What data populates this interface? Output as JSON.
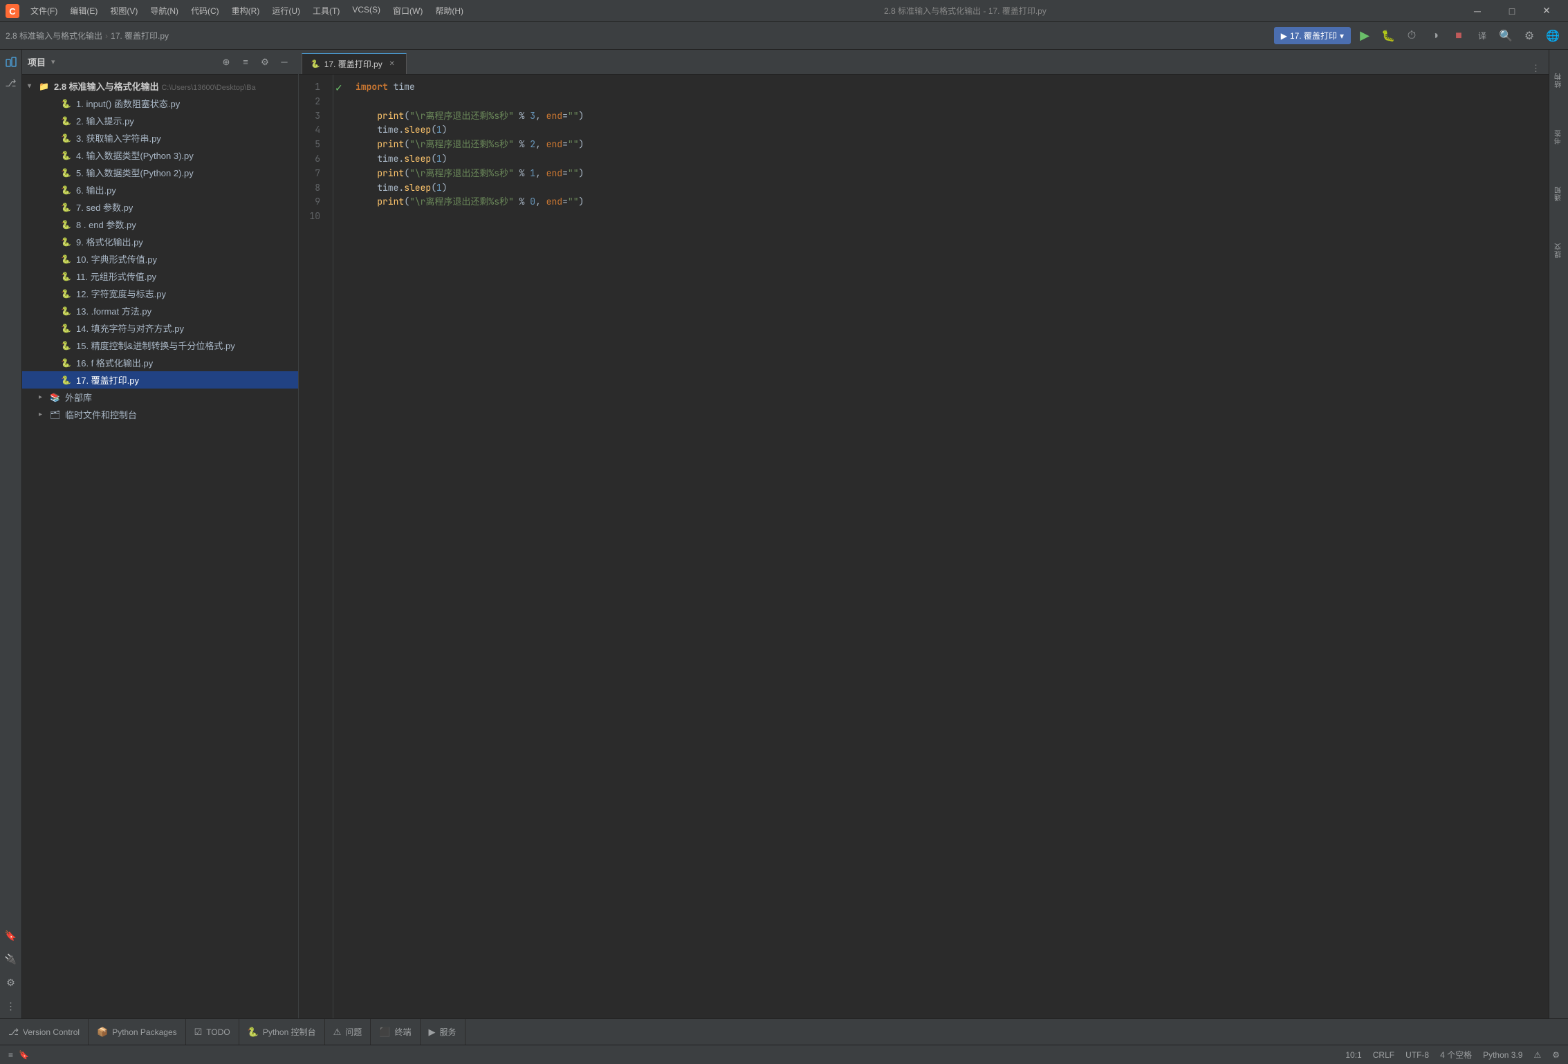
{
  "window": {
    "title": "2.8 标准输入与格式化输出 - 17. 覆盖打印.py",
    "logo": "🐉"
  },
  "titlebar": {
    "menus": [
      "文件(F)",
      "编辑(E)",
      "视图(V)",
      "导航(N)",
      "代码(C)",
      "重构(R)",
      "运行(U)",
      "工具(T)",
      "VCS(S)",
      "窗口(W)",
      "帮助(H)"
    ],
    "center_text": "2.8 标准输入与格式化输出 - 17. 覆盖打印.py",
    "minimize": "─",
    "maximize": "□",
    "close": "✕"
  },
  "toolbar": {
    "breadcrumb_root": "2.8 标准输入与格式化输出",
    "breadcrumb_sep": "›",
    "breadcrumb_file": "17. 覆盖打印.py",
    "run_config": "17. 覆盖打印",
    "run_icon": "▶",
    "debug_icon": "🐛",
    "profile_icon": "⏱",
    "coverage_icon": "◑",
    "stop_icon": "■",
    "translate_icon": "译",
    "search_icon": "🔍",
    "settings_icon": "⚙",
    "theme_icon": "🌐"
  },
  "sidebar": {
    "panel_title": "项目",
    "dropdown_icon": "▾"
  },
  "file_tree": {
    "root_label": "2.8 标准输入与格式化输出",
    "root_path": "C:\\Users\\13600\\Desktop\\Ba",
    "items": [
      {
        "id": 1,
        "label": "1. input() 函数阻塞状态.py",
        "indent": 2,
        "type": "py"
      },
      {
        "id": 2,
        "label": "2. 输入提示.py",
        "indent": 2,
        "type": "py"
      },
      {
        "id": 3,
        "label": "3. 获取输入字符串.py",
        "indent": 2,
        "type": "py"
      },
      {
        "id": 4,
        "label": "4. 输入数据类型(Python 3).py",
        "indent": 2,
        "type": "py"
      },
      {
        "id": 5,
        "label": "5. 输入数据类型(Python 2).py",
        "indent": 2,
        "type": "py"
      },
      {
        "id": 6,
        "label": "6. 输出.py",
        "indent": 2,
        "type": "py"
      },
      {
        "id": 7,
        "label": "7. sed 参数.py",
        "indent": 2,
        "type": "py"
      },
      {
        "id": 8,
        "label": "8 . end 参数.py",
        "indent": 2,
        "type": "py"
      },
      {
        "id": 9,
        "label": "9. 格式化输出.py",
        "indent": 2,
        "type": "py"
      },
      {
        "id": 10,
        "label": "10. 字典形式传值.py",
        "indent": 2,
        "type": "py"
      },
      {
        "id": 11,
        "label": "11. 元组形式传值.py",
        "indent": 2,
        "type": "py"
      },
      {
        "id": 12,
        "label": "12. 字符宽度与标志.py",
        "indent": 2,
        "type": "py"
      },
      {
        "id": 13,
        "label": "13. .format 方法.py",
        "indent": 2,
        "type": "py"
      },
      {
        "id": 14,
        "label": "14. 填充字符与对齐方式.py",
        "indent": 2,
        "type": "py"
      },
      {
        "id": 15,
        "label": "15. 精度控制&进制转换与千分位格式.py",
        "indent": 2,
        "type": "py"
      },
      {
        "id": 16,
        "label": "16. f 格式化输出.py",
        "indent": 2,
        "type": "py"
      },
      {
        "id": 17,
        "label": "17. 覆盖打印.py",
        "indent": 2,
        "type": "py",
        "selected": true
      }
    ],
    "group_items": [
      {
        "label": "外部库",
        "collapsed": true,
        "indent": 1
      },
      {
        "label": "临时文件和控制台",
        "collapsed": true,
        "indent": 1
      }
    ]
  },
  "editor": {
    "tab_label": "17. 覆盖打印.py",
    "tab_modified": false,
    "code_lines": [
      {
        "num": 1,
        "content": "import time",
        "tokens": [
          {
            "text": "import",
            "cls": "kw"
          },
          {
            "text": " time",
            "cls": "plain"
          }
        ]
      },
      {
        "num": 2,
        "content": "",
        "tokens": []
      },
      {
        "num": 3,
        "content": "    print(\"\\r离程序退出还剩%s秒\" % 3, end=\"\")",
        "tokens": [
          {
            "text": "    ",
            "cls": "plain"
          },
          {
            "text": "print",
            "cls": "fn"
          },
          {
            "text": "(",
            "cls": "plain"
          },
          {
            "text": "\"\\r离程序退出还剩%s秒\"",
            "cls": "str"
          },
          {
            "text": " % ",
            "cls": "plain"
          },
          {
            "text": "3",
            "cls": "num"
          },
          {
            "text": ", ",
            "cls": "plain"
          },
          {
            "text": "end",
            "cls": "param-kw"
          },
          {
            "text": "=",
            "cls": "plain"
          },
          {
            "text": "\"\"",
            "cls": "str"
          },
          {
            "text": ")",
            "cls": "plain"
          }
        ]
      },
      {
        "num": 4,
        "content": "    time.sleep(1)",
        "tokens": [
          {
            "text": "    time.",
            "cls": "plain"
          },
          {
            "text": "sleep",
            "cls": "fn"
          },
          {
            "text": "(",
            "cls": "plain"
          },
          {
            "text": "1",
            "cls": "num"
          },
          {
            "text": ")",
            "cls": "plain"
          }
        ]
      },
      {
        "num": 5,
        "content": "    print(\"\\r离程序退出还剩%s秒\" % 2, end=\"\")",
        "tokens": [
          {
            "text": "    ",
            "cls": "plain"
          },
          {
            "text": "print",
            "cls": "fn"
          },
          {
            "text": "(",
            "cls": "plain"
          },
          {
            "text": "\"\\r离程序退出还剩%s秒\"",
            "cls": "str"
          },
          {
            "text": " % ",
            "cls": "plain"
          },
          {
            "text": "2",
            "cls": "num"
          },
          {
            "text": ", ",
            "cls": "plain"
          },
          {
            "text": "end",
            "cls": "param-kw"
          },
          {
            "text": "=",
            "cls": "plain"
          },
          {
            "text": "\"\"",
            "cls": "str"
          },
          {
            "text": ")",
            "cls": "plain"
          }
        ]
      },
      {
        "num": 6,
        "content": "    time.sleep(1)",
        "tokens": [
          {
            "text": "    time.",
            "cls": "plain"
          },
          {
            "text": "sleep",
            "cls": "fn"
          },
          {
            "text": "(",
            "cls": "plain"
          },
          {
            "text": "1",
            "cls": "num"
          },
          {
            "text": ")",
            "cls": "plain"
          }
        ]
      },
      {
        "num": 7,
        "content": "    print(\"\\r离程序退出还剩%s秒\" % 1, end=\"\")",
        "tokens": [
          {
            "text": "    ",
            "cls": "plain"
          },
          {
            "text": "print",
            "cls": "fn"
          },
          {
            "text": "(",
            "cls": "plain"
          },
          {
            "text": "\"\\r离程序退出还剩%s秒\"",
            "cls": "str"
          },
          {
            "text": " % ",
            "cls": "plain"
          },
          {
            "text": "1",
            "cls": "num"
          },
          {
            "text": ", ",
            "cls": "plain"
          },
          {
            "text": "end",
            "cls": "param-kw"
          },
          {
            "text": "=",
            "cls": "plain"
          },
          {
            "text": "\"\"",
            "cls": "str"
          },
          {
            "text": ")",
            "cls": "plain"
          }
        ]
      },
      {
        "num": 8,
        "content": "    time.sleep(1)",
        "tokens": [
          {
            "text": "    time.",
            "cls": "plain"
          },
          {
            "text": "sleep",
            "cls": "fn"
          },
          {
            "text": "(",
            "cls": "plain"
          },
          {
            "text": "1",
            "cls": "num"
          },
          {
            "text": ")",
            "cls": "plain"
          }
        ]
      },
      {
        "num": 9,
        "content": "    print(\"\\r离程序退出还剩%s秒\" % 0, end=\"\")",
        "tokens": [
          {
            "text": "    ",
            "cls": "plain"
          },
          {
            "text": "print",
            "cls": "fn"
          },
          {
            "text": "(",
            "cls": "plain"
          },
          {
            "text": "\"\\r离程序退出还剩%s秒\"",
            "cls": "str"
          },
          {
            "text": " % ",
            "cls": "plain"
          },
          {
            "text": "0",
            "cls": "num"
          },
          {
            "text": ", ",
            "cls": "plain"
          },
          {
            "text": "end",
            "cls": "param-kw"
          },
          {
            "text": "=",
            "cls": "plain"
          },
          {
            "text": "\"\"",
            "cls": "str"
          },
          {
            "text": ")",
            "cls": "plain"
          }
        ]
      },
      {
        "num": 10,
        "content": "",
        "tokens": []
      }
    ],
    "gutter_check_line": 1
  },
  "right_panels": [
    {
      "label": "结构",
      "id": "structure"
    },
    {
      "label": "书签",
      "id": "bookmarks"
    },
    {
      "label": "Git",
      "id": "git"
    },
    {
      "label": "提交",
      "id": "commit"
    }
  ],
  "bottom_tabs": [
    {
      "label": "Version Control",
      "icon": "⎇",
      "id": "version-control"
    },
    {
      "label": "Python Packages",
      "icon": "📦",
      "id": "python-packages"
    },
    {
      "label": "TODO",
      "icon": "☑",
      "id": "todo"
    },
    {
      "label": "Python 控制台",
      "icon": "🐍",
      "id": "python-console"
    },
    {
      "label": "问题",
      "icon": "⚠",
      "id": "issues"
    },
    {
      "label": "终端",
      "icon": "⬛",
      "id": "terminal"
    },
    {
      "label": "服务",
      "icon": "▶",
      "id": "services"
    }
  ],
  "status_bar": {
    "left_icons": [
      "≡",
      "🔖"
    ],
    "cursor_pos": "10:1",
    "line_ending": "CRLF",
    "encoding": "UTF-8",
    "indent": "4 个空格",
    "python_version": "Python 3.9",
    "warning_icon": "⚠",
    "settings_icon": "⚙"
  }
}
